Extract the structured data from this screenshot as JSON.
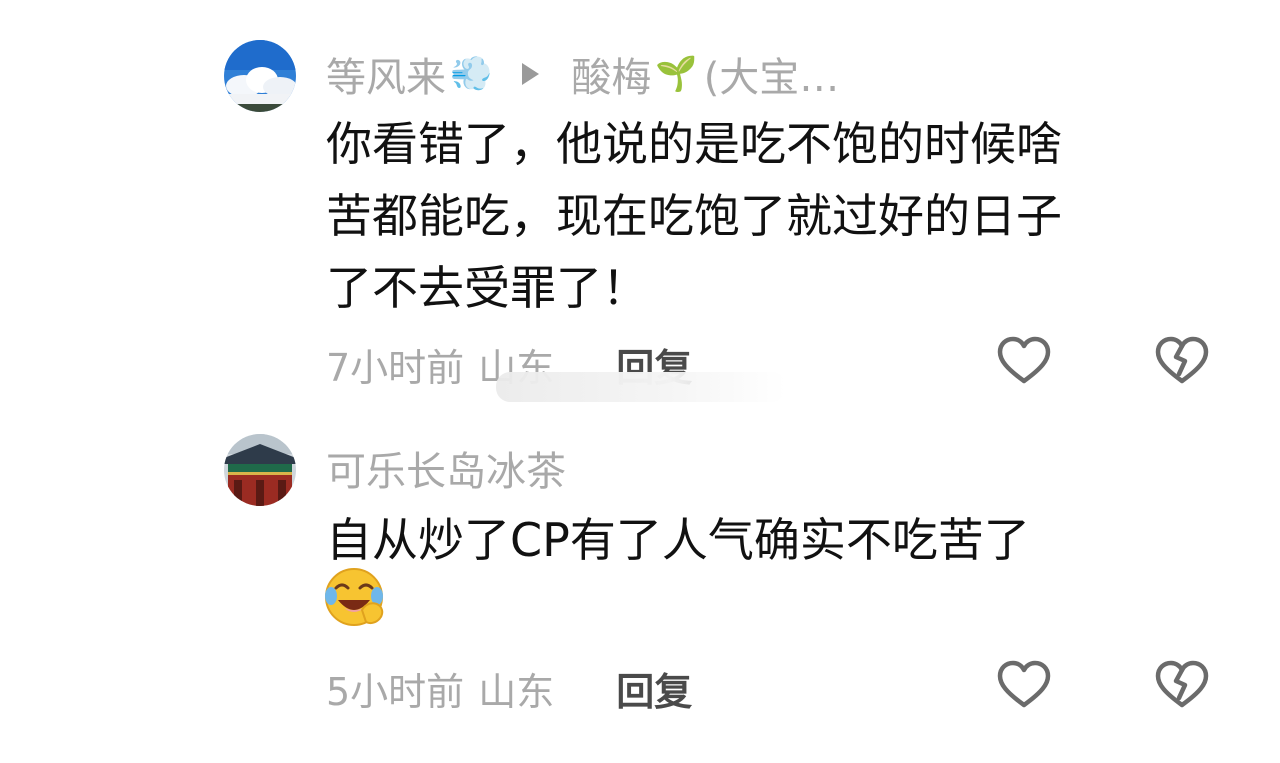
{
  "comments": [
    {
      "author": "等风来",
      "author_emoji": "💨",
      "reply_to": "酸梅",
      "reply_to_emoji": "🌱",
      "reply_to_suffix": "(大宝…",
      "lines": [
        "你看错了，他说的是吃不饱的时候啥",
        "苦都能吃，现在吃饱了就过好的日子",
        "了不去受罪了！"
      ],
      "time": "7小时前",
      "location": "山东",
      "reply_label": "回复"
    },
    {
      "author": "可乐长岛冰茶",
      "lines": [
        "自从炒了CP有了人气确实不吃苦了"
      ],
      "emoji": "😭",
      "time": "5小时前",
      "location": "山东",
      "reply_label": "回复"
    }
  ],
  "icons": {
    "like": "heart-outline-icon",
    "dislike": "broken-heart-icon",
    "reply_arrow": "play-arrow-icon"
  },
  "colors": {
    "meta_text": "#a9a9a9",
    "body_text": "#111111",
    "reply_text": "#4a4a4a",
    "icon_stroke": "#6b6b6b"
  }
}
